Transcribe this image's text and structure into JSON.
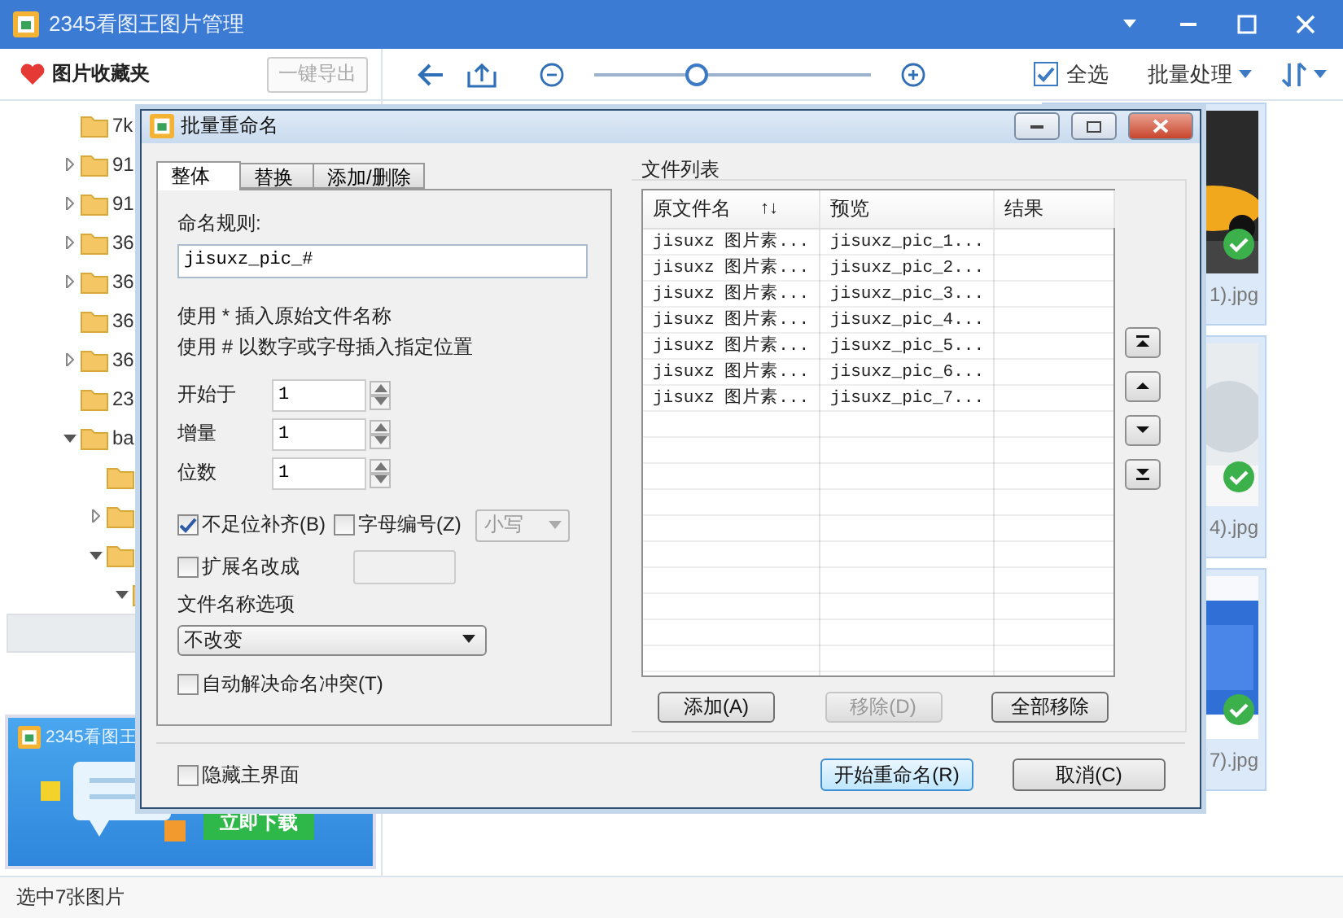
{
  "window": {
    "title": "2345看图王图片管理"
  },
  "toolbar": {
    "favorites_label": "图片收藏夹",
    "export_button": {
      "label": "一键导出",
      "disabled": true
    },
    "zoom": {
      "level": 0.37
    },
    "select_all": {
      "label": "全选",
      "checked": true
    },
    "batch_menu": "批量处理"
  },
  "sidebar": {
    "tree": [
      {
        "label": "7k",
        "kind": "leaf",
        "expanded": false,
        "selected": false
      },
      {
        "label": "91",
        "kind": "branch",
        "expanded": false,
        "selected": false
      },
      {
        "label": "91",
        "kind": "branch",
        "expanded": false,
        "selected": false
      },
      {
        "label": "36",
        "kind": "branch",
        "expanded": false,
        "selected": false
      },
      {
        "label": "36",
        "kind": "branch",
        "expanded": false,
        "selected": false
      },
      {
        "label": "36",
        "kind": "leaf",
        "expanded": false,
        "selected": false
      },
      {
        "label": "36",
        "kind": "branch",
        "expanded": false,
        "selected": false
      },
      {
        "label": "23",
        "kind": "leaf",
        "expanded": false,
        "selected": false
      },
      {
        "label": "ba",
        "kind": "branch",
        "expanded": true,
        "selected": false,
        "children": [
          {
            "kind": "leaf",
            "expanded": false,
            "selected": false
          },
          {
            "kind": "branch",
            "expanded": false,
            "selected": false
          },
          {
            "kind": "branch",
            "expanded": true,
            "selected": false,
            "children": [
              {
                "kind": "branch",
                "expanded": true,
                "selected": false,
                "children": [
                  {
                    "selected": true
                  }
                ]
              }
            ]
          }
        ]
      }
    ],
    "ad": {
      "title": "2345看图王",
      "button": "立即下载"
    }
  },
  "thumbnails": [
    {
      "caption": "1).jpg",
      "checked": true
    },
    {
      "caption": "4).jpg",
      "checked": true
    },
    {
      "caption": "7).jpg",
      "checked": true
    }
  ],
  "status_bar": "选中7张图片",
  "dialog": {
    "title": "批量重命名",
    "tabs": [
      {
        "label": "整体",
        "selected": true
      },
      {
        "label": "替换",
        "selected": false
      },
      {
        "label": "添加/删除",
        "selected": false
      }
    ],
    "rule_label": "命名规则:",
    "rule_value": "jisuxz_pic_#",
    "hints": [
      "使用 * 插入原始文件名称",
      "使用 # 以数字或字母插入指定位置"
    ],
    "spinners": [
      {
        "label": "开始于",
        "value": "1"
      },
      {
        "label": "增量",
        "value": "1"
      },
      {
        "label": "位数",
        "value": "1"
      }
    ],
    "options": [
      {
        "label": "不足位补齐(B)",
        "checked": true
      },
      {
        "label": "字母编号(Z)",
        "checked": false
      }
    ],
    "case_select": {
      "value": "小写",
      "disabled": true
    },
    "extension": {
      "label": "扩展名改成",
      "checked": false,
      "disabled": true
    },
    "name_option_label": "文件名称选项",
    "name_option": "不改变",
    "auto_resolve": {
      "label": "自动解决命名冲突(T)",
      "checked": false
    },
    "file_list": {
      "title": "文件列表",
      "columns": [
        {
          "label": "原文件名",
          "sort_mark": "↑↓"
        },
        {
          "label": "预览"
        },
        {
          "label": "结果"
        }
      ],
      "rows": [
        {
          "original": "jisuxz 图片素...",
          "preview": "jisuxz_pic_1..."
        },
        {
          "original": "jisuxz 图片素...",
          "preview": "jisuxz_pic_2..."
        },
        {
          "original": "jisuxz 图片素...",
          "preview": "jisuxz_pic_3..."
        },
        {
          "original": "jisuxz 图片素...",
          "preview": "jisuxz_pic_4..."
        },
        {
          "original": "jisuxz 图片素...",
          "preview": "jisuxz_pic_5..."
        },
        {
          "original": "jisuxz 图片素...",
          "preview": "jisuxz_pic_6..."
        },
        {
          "original": "jisuxz 图片素...",
          "preview": "jisuxz_pic_7..."
        }
      ],
      "buttons": [
        {
          "label": "添加(A)",
          "disabled": false
        },
        {
          "label": "移除(D)",
          "disabled": true
        },
        {
          "label": "全部移除",
          "disabled": false
        }
      ]
    },
    "hide_main": {
      "label": "隐藏主界面",
      "checked": false
    },
    "buttons": [
      {
        "label": "开始重命名(R)",
        "default": true
      },
      {
        "label": "取消(C)",
        "default": false
      }
    ]
  }
}
